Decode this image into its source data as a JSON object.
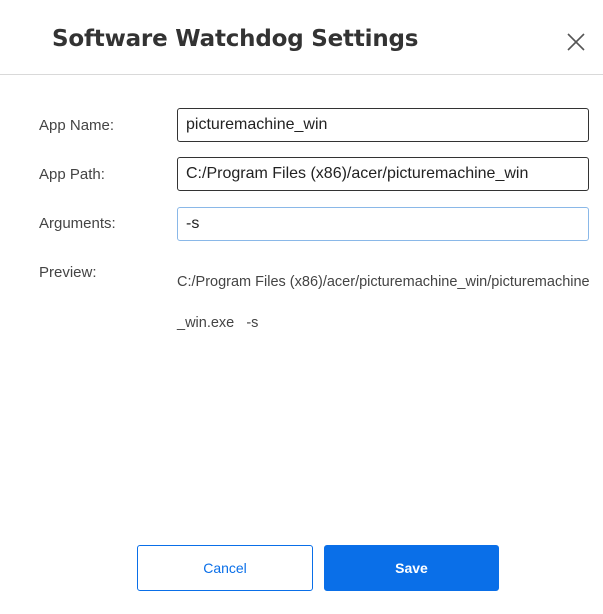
{
  "dialog": {
    "title": "Software Watchdog Settings",
    "close_icon": "close-icon"
  },
  "form": {
    "app_name_label": "App Name:",
    "app_name_value": "picturemachine_win",
    "app_path_label": "App Path:",
    "app_path_value": "C:/Program Files (x86)/acer/picturemachine_win",
    "arguments_label": "Arguments:",
    "arguments_value": "-s",
    "preview_label": "Preview:",
    "preview_value": "C:/Program Files (x86)/acer/picturemachine_win/picturemachine_win.exe   -s"
  },
  "buttons": {
    "cancel_label": "Cancel",
    "save_label": "Save"
  },
  "colors": {
    "accent": "#0a6fe8",
    "focus_border": "#8ab8e8"
  }
}
